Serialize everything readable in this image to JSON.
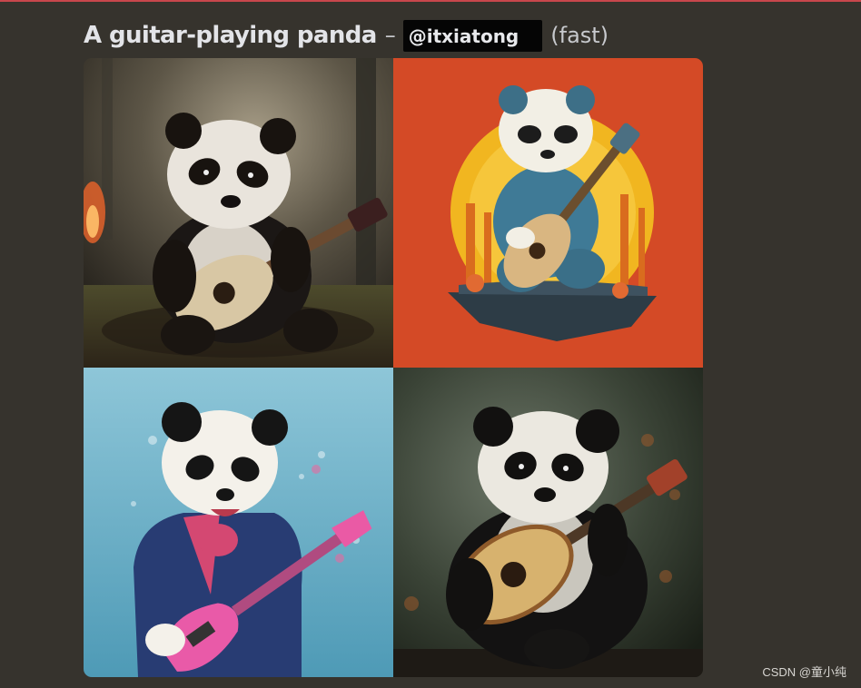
{
  "message": {
    "prompt_text": "A guitar-playing panda",
    "separator": "–",
    "mention": "@itxiatong",
    "mode": "(fast)"
  },
  "image_grid": {
    "tiles": [
      {
        "subject": "panda playing acoustic guitar in forest",
        "style": "photorealistic"
      },
      {
        "subject": "panda in blue jacket playing guitar",
        "style": "illustrated on orange background"
      },
      {
        "subject": "panda in jacket playing pink electric guitar",
        "style": "illustrated on blue background"
      },
      {
        "subject": "panda playing acoustic guitar",
        "style": "oil painting"
      }
    ]
  },
  "watermark": "CSDN @童小纯",
  "colors": {
    "background": "#36332d",
    "accent_line": "#c8474c",
    "mention_bg": "#050505"
  }
}
